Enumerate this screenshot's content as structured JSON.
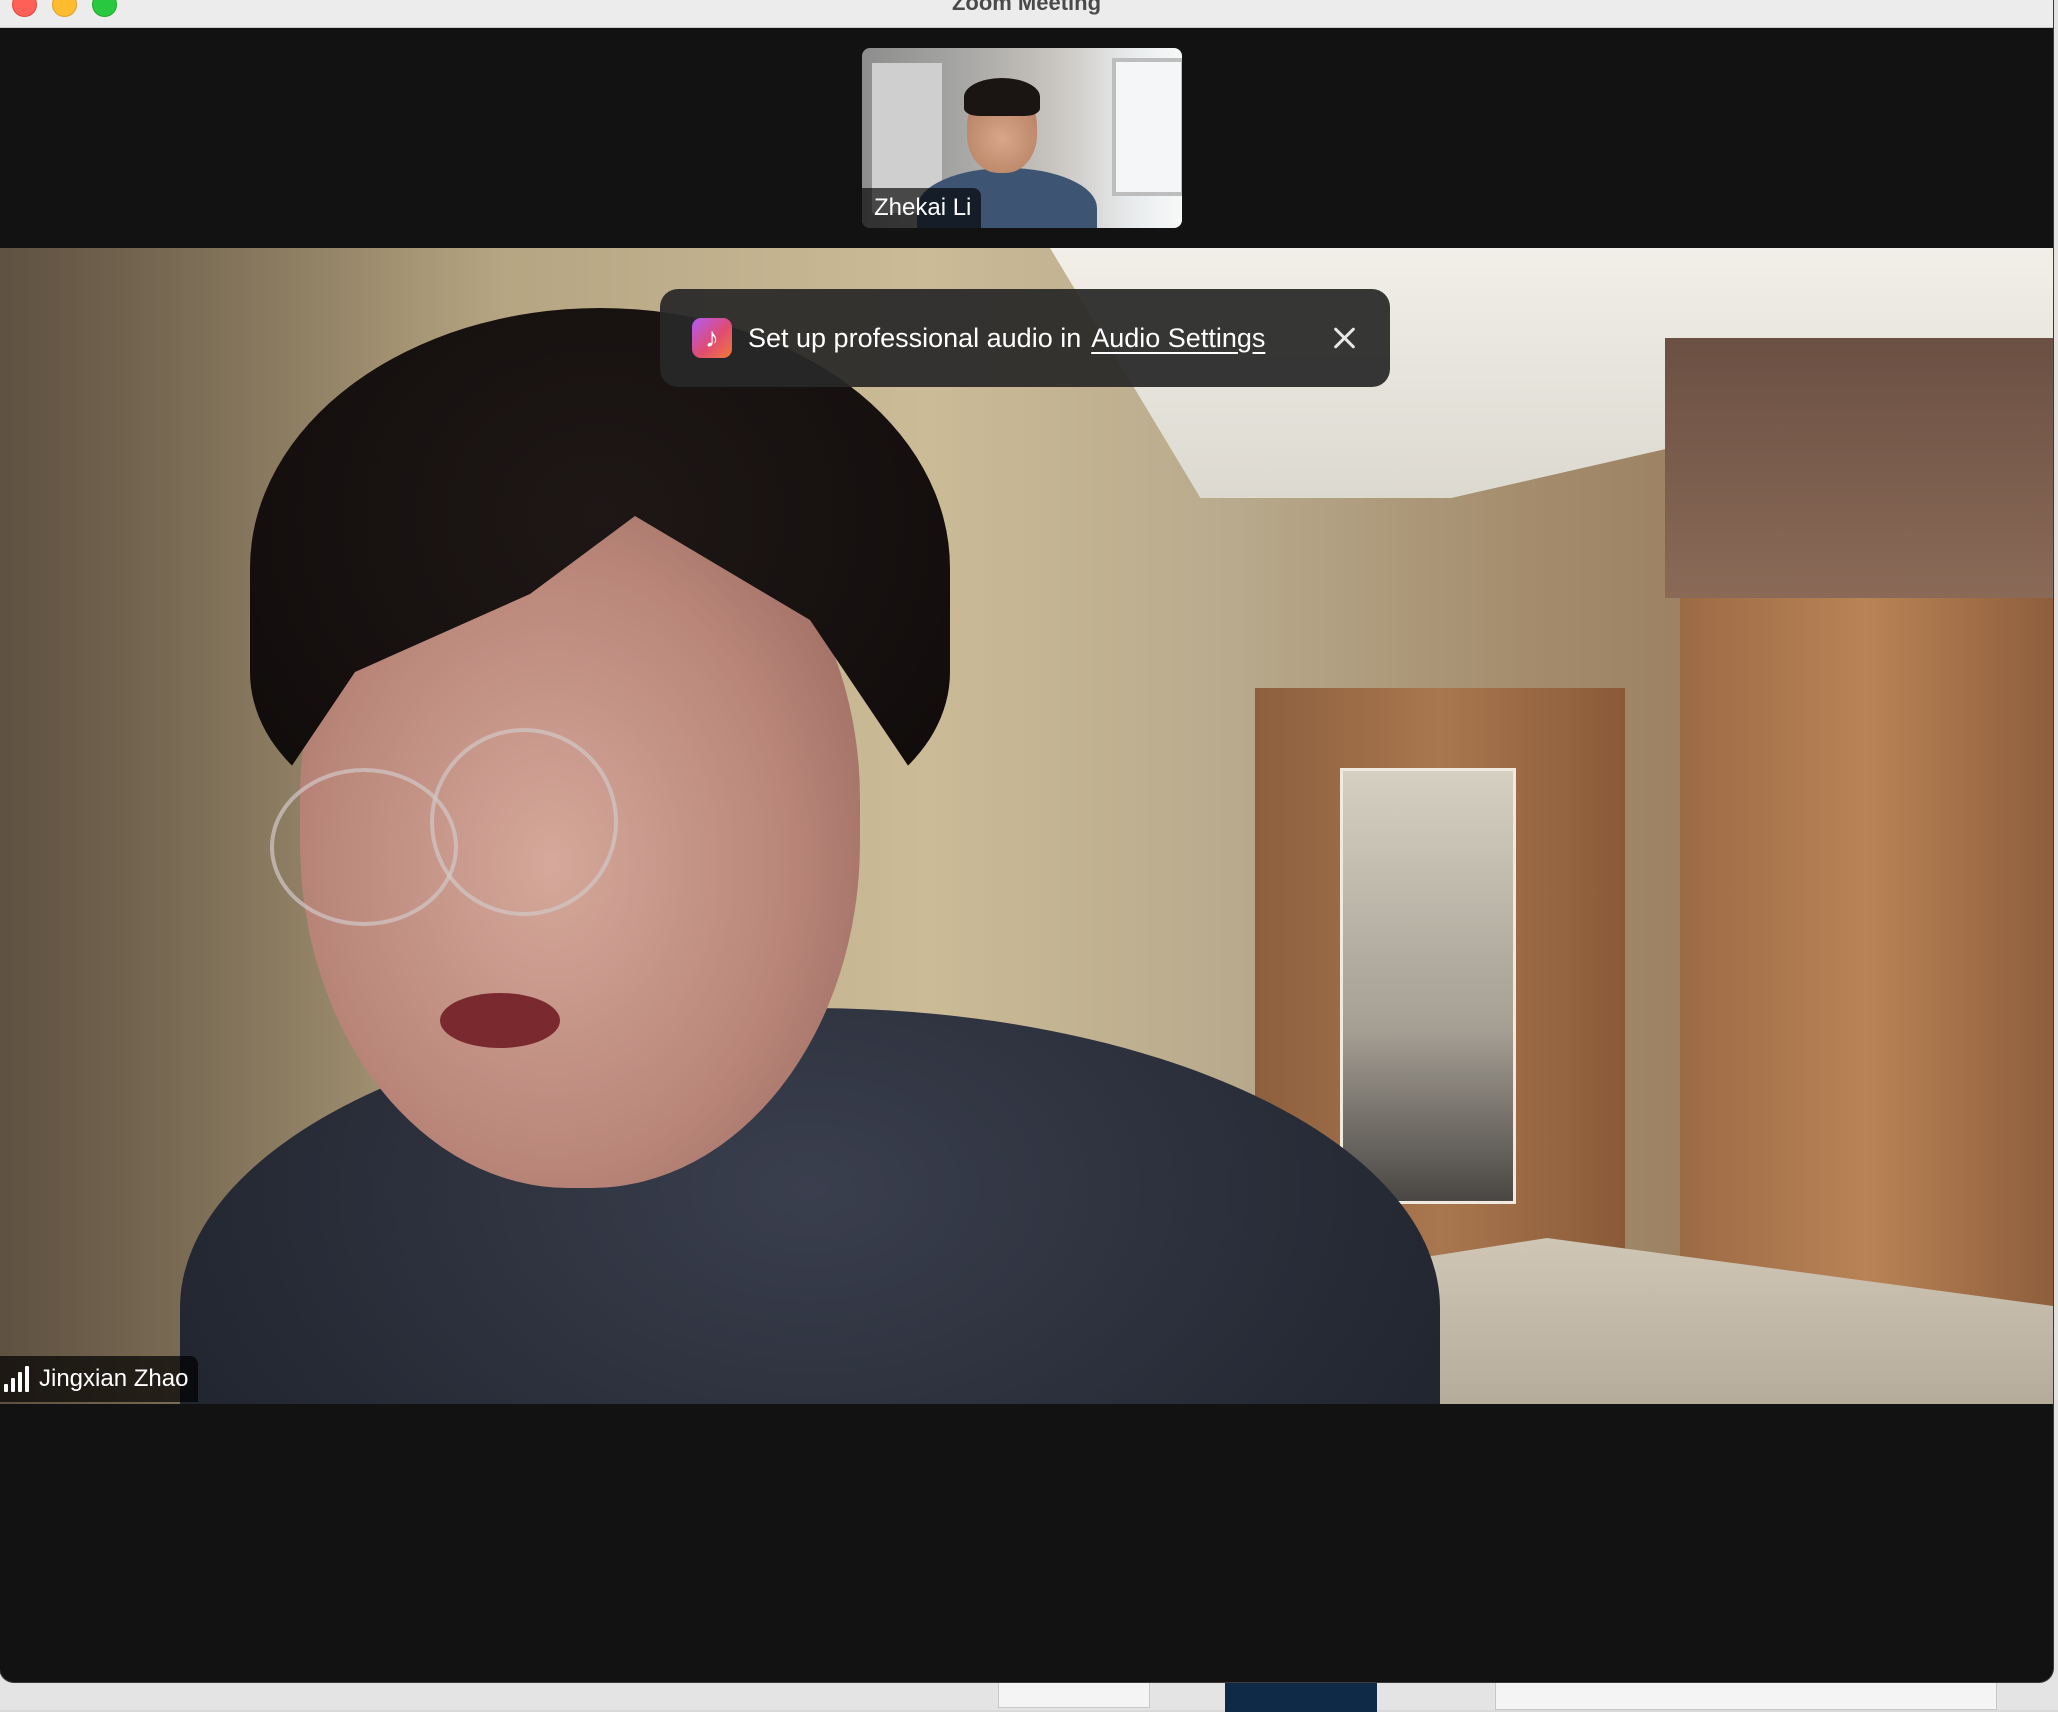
{
  "window": {
    "title": "Zoom Meeting"
  },
  "thumbnail": {
    "participant_name": "Zhekai Li"
  },
  "banner": {
    "icon": "music-note-icon",
    "message": "Set up professional audio in",
    "link_label": "Audio Settings",
    "close_icon": "close-icon"
  },
  "main_video": {
    "participant_name": "Jingxian Zhao",
    "signal_icon": "signal-strength-icon"
  },
  "colors": {
    "background": "#121212",
    "banner_bg": "#282828",
    "banner_icon_gradient": [
      "#b05cf5",
      "#e14b72",
      "#f07a3a"
    ]
  }
}
